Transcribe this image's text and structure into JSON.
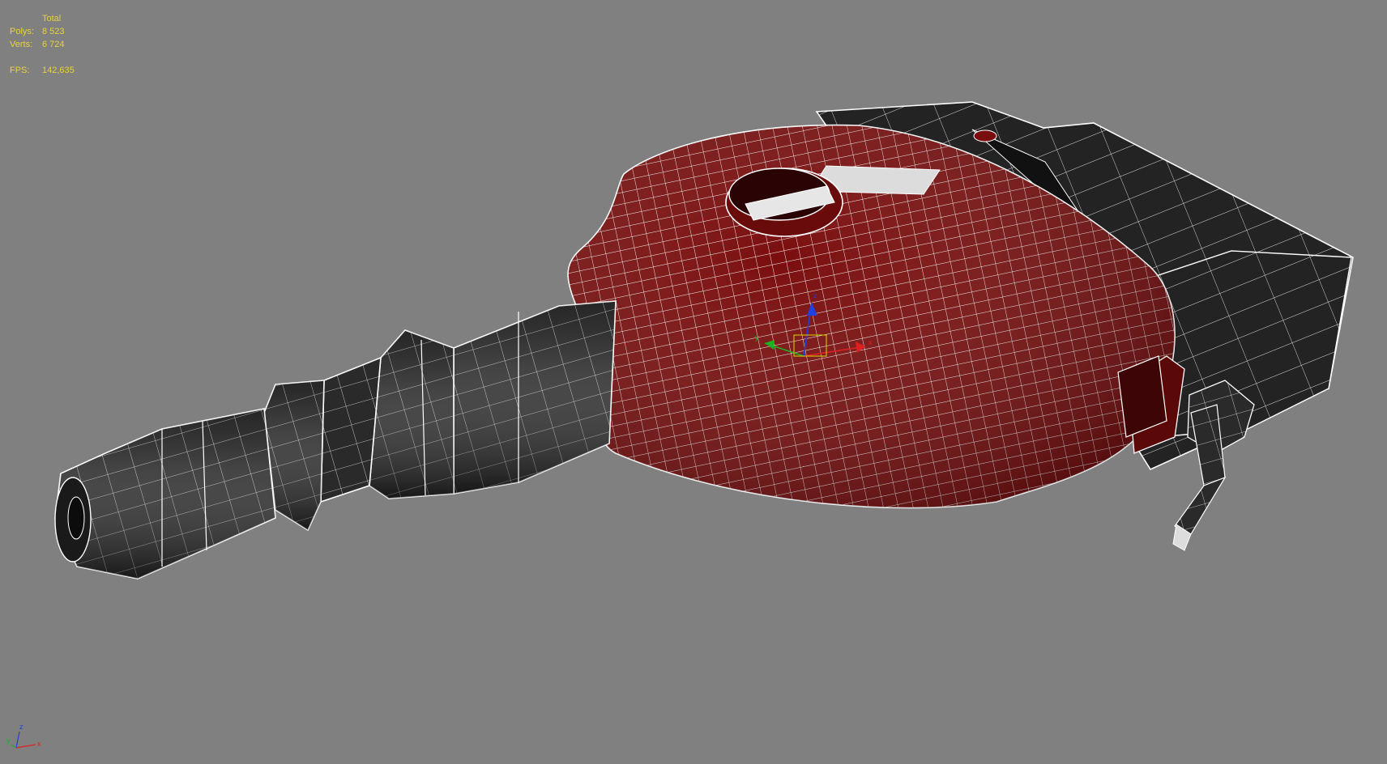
{
  "viewport": {
    "background_color": "#808080",
    "stats": {
      "header": "Total",
      "polys_label": "Polys:",
      "polys_value": "8 523",
      "verts_label": "Verts:",
      "verts_value": "6 724",
      "fps_label": "FPS:",
      "fps_value": "142,635",
      "text_color": "#e8d23a"
    },
    "model": {
      "body_color": "#7a0d0d",
      "parts_color": "#262626",
      "wire_color": "#ffffff"
    },
    "gizmo": {
      "x_label": "x",
      "y_label": "y",
      "z_label": "z"
    },
    "world_axis": {
      "x_label": "x",
      "y_label": "y",
      "z_label": "z",
      "icon": "world-axis-tripod-icon"
    }
  }
}
